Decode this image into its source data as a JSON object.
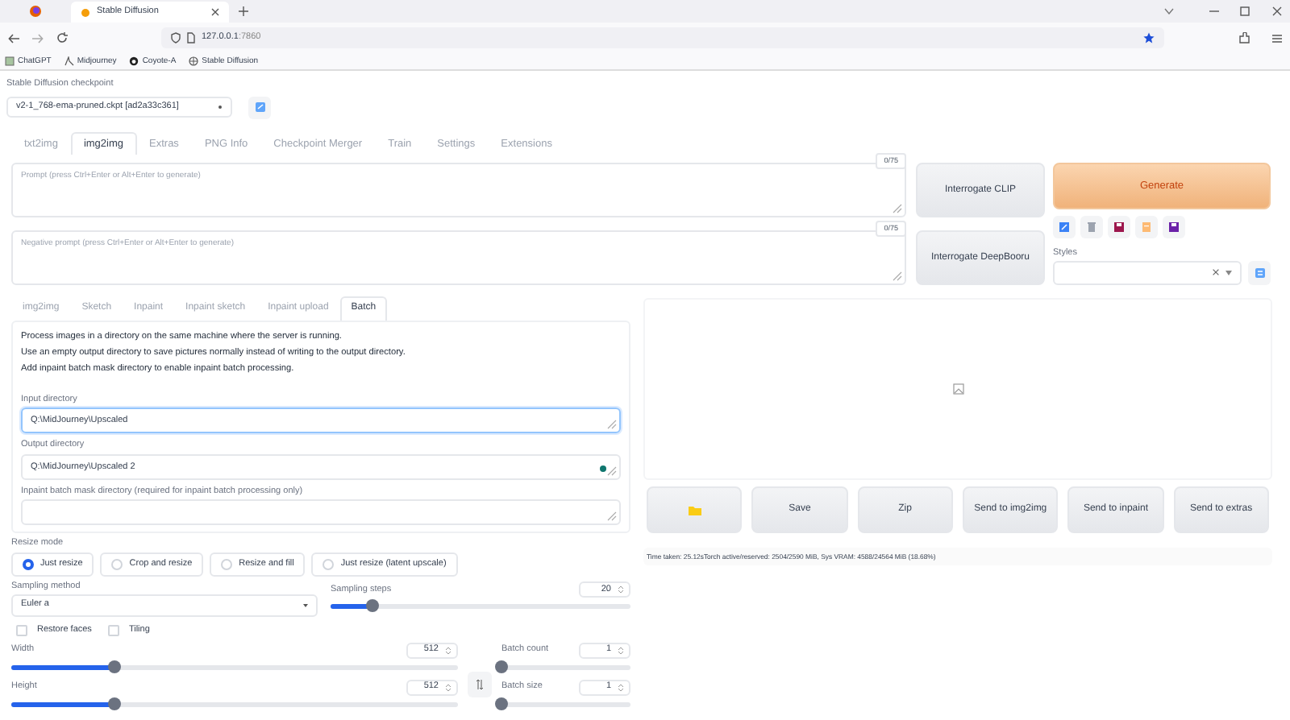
{
  "browser": {
    "tab_title": "Stable Diffusion",
    "url_host": "127.0.0.1",
    "url_port": ":7860",
    "bookmarks": [
      "ChatGPT",
      "Midjourney",
      "Coyote-A",
      "Stable Diffusion"
    ]
  },
  "checkpoint": {
    "label": "Stable Diffusion checkpoint",
    "value": "v2-1_768-ema-pruned.ckpt [ad2a33c361]"
  },
  "main_tabs": [
    {
      "label": "txt2img",
      "selected": false
    },
    {
      "label": "img2img",
      "selected": true
    },
    {
      "label": "Extras",
      "selected": false
    },
    {
      "label": "PNG Info",
      "selected": false
    },
    {
      "label": "Checkpoint Merger",
      "selected": false
    },
    {
      "label": "Train",
      "selected": false
    },
    {
      "label": "Settings",
      "selected": false
    },
    {
      "label": "Extensions",
      "selected": false
    }
  ],
  "prompts": [
    {
      "placeholder": "Prompt (press Ctrl+Enter or Alt+Enter to generate)",
      "token_count": "0/75"
    },
    {
      "placeholder": "Negative prompt (press Ctrl+Enter or Alt+Enter to generate)",
      "token_count": "0/75"
    }
  ],
  "interrogate_buttons": [
    "Interrogate CLIP",
    "Interrogate DeepBooru"
  ],
  "generate_button": "Generate",
  "styles": {
    "label": "Styles"
  },
  "sub_tabs": [
    {
      "label": "img2img",
      "selected": false
    },
    {
      "label": "Sketch",
      "selected": false
    },
    {
      "label": "Inpaint",
      "selected": false
    },
    {
      "label": "Inpaint sketch",
      "selected": false
    },
    {
      "label": "Inpaint upload",
      "selected": false
    },
    {
      "label": "Batch",
      "selected": true
    }
  ],
  "batch": {
    "description": [
      "Process images in a directory on the same machine where the server is running.",
      "Use an empty output directory to save pictures normally instead of writing to the output directory.",
      "Add inpaint batch mask directory to enable inpaint batch processing."
    ],
    "fields": [
      {
        "label": "Input directory",
        "value": "Q:\\MidJourney\\Upscaled",
        "focused": true
      },
      {
        "label": "Output directory",
        "value": "Q:\\MidJourney\\Upscaled 2",
        "focused": false
      },
      {
        "label": "Inpaint batch mask directory (required for inpaint batch processing only)",
        "focused": false
      }
    ]
  },
  "resize_mode": {
    "label": "Resize mode",
    "options": [
      {
        "label": "Just resize",
        "selected": true
      },
      {
        "label": "Crop and resize",
        "selected": false
      },
      {
        "label": "Resize and fill",
        "selected": false
      },
      {
        "label": "Just resize (latent upscale)",
        "selected": false
      }
    ]
  },
  "sampling_method": {
    "label": "Sampling method",
    "value": "Euler a"
  },
  "sampling_steps": {
    "label": "Sampling steps",
    "value": "20",
    "level": 0.14
  },
  "checkboxes": [
    {
      "label": "Restore faces",
      "checked": false
    },
    {
      "label": "Tiling",
      "checked": false
    }
  ],
  "size_sliders": [
    {
      "label": "Width",
      "value": "512",
      "level": 0.23
    },
    {
      "label": "Height",
      "value": "512",
      "level": 0.23
    }
  ],
  "batch_sliders": [
    {
      "label": "Batch count",
      "value": "1",
      "level": 0
    },
    {
      "label": "Batch size",
      "value": "1",
      "level": 0
    }
  ],
  "output_buttons": [
    {
      "kind": "folder"
    },
    {
      "kind": "text",
      "label": "Save"
    },
    {
      "kind": "text",
      "label": "Zip"
    },
    {
      "kind": "text",
      "label": "Send to img2img"
    },
    {
      "kind": "text",
      "label": "Send to inpaint"
    },
    {
      "kind": "text",
      "label": "Send to extras"
    }
  ],
  "status": "Time taken: 25.12sTorch active/reserved: 2504/2590 MiB, Sys VRAM: 4588/24564 MiB (18.68%)"
}
